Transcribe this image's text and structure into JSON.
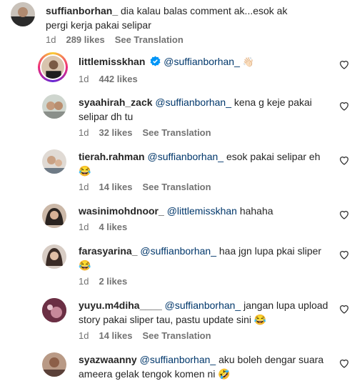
{
  "comments": [
    {
      "username": "suffianborhan_",
      "mention": "",
      "text": "dia kalau balas comment ak...esok ak pergi kerja pakai selipar",
      "time": "1d",
      "likes": "289 likes",
      "translate": "See Translation"
    },
    {
      "username": "littlemisskhan",
      "mention": "@suffianborhan_",
      "text": "👋🏻",
      "time": "1d",
      "likes": "442 likes",
      "translate": ""
    },
    {
      "username": "syaahirah_zack",
      "mention": "@suffianborhan_",
      "text": "kena g keje pakai selipar dh tu",
      "time": "1d",
      "likes": "32 likes",
      "translate": "See Translation"
    },
    {
      "username": "tierah.rahman",
      "mention": "@suffianborhan_",
      "text": "esok pakai selipar eh😂",
      "time": "1d",
      "likes": "14 likes",
      "translate": "See Translation"
    },
    {
      "username": "wasinimohdnoor_",
      "mention": "@littlemisskhan",
      "text": "hahaha",
      "time": "1d",
      "likes": "4 likes",
      "translate": ""
    },
    {
      "username": "farasyarina_",
      "mention": "@suffianborhan_",
      "text": "haa jgn lupa pkai sliper😂",
      "time": "1d",
      "likes": "2 likes",
      "translate": ""
    },
    {
      "username": "yuyu.m4diha____",
      "mention": "@suffianborhan_",
      "text": "jangan lupa upload story pakai sliper tau, pastu update sini 😂",
      "time": "1d",
      "likes": "14 likes",
      "translate": "See Translation"
    },
    {
      "username": "syazwaanny",
      "mention": "@suffianborhan_",
      "text": "aku boleh dengar suara ameera gelak tengok komen ni 🤣",
      "time": "",
      "likes": "",
      "translate": ""
    }
  ]
}
